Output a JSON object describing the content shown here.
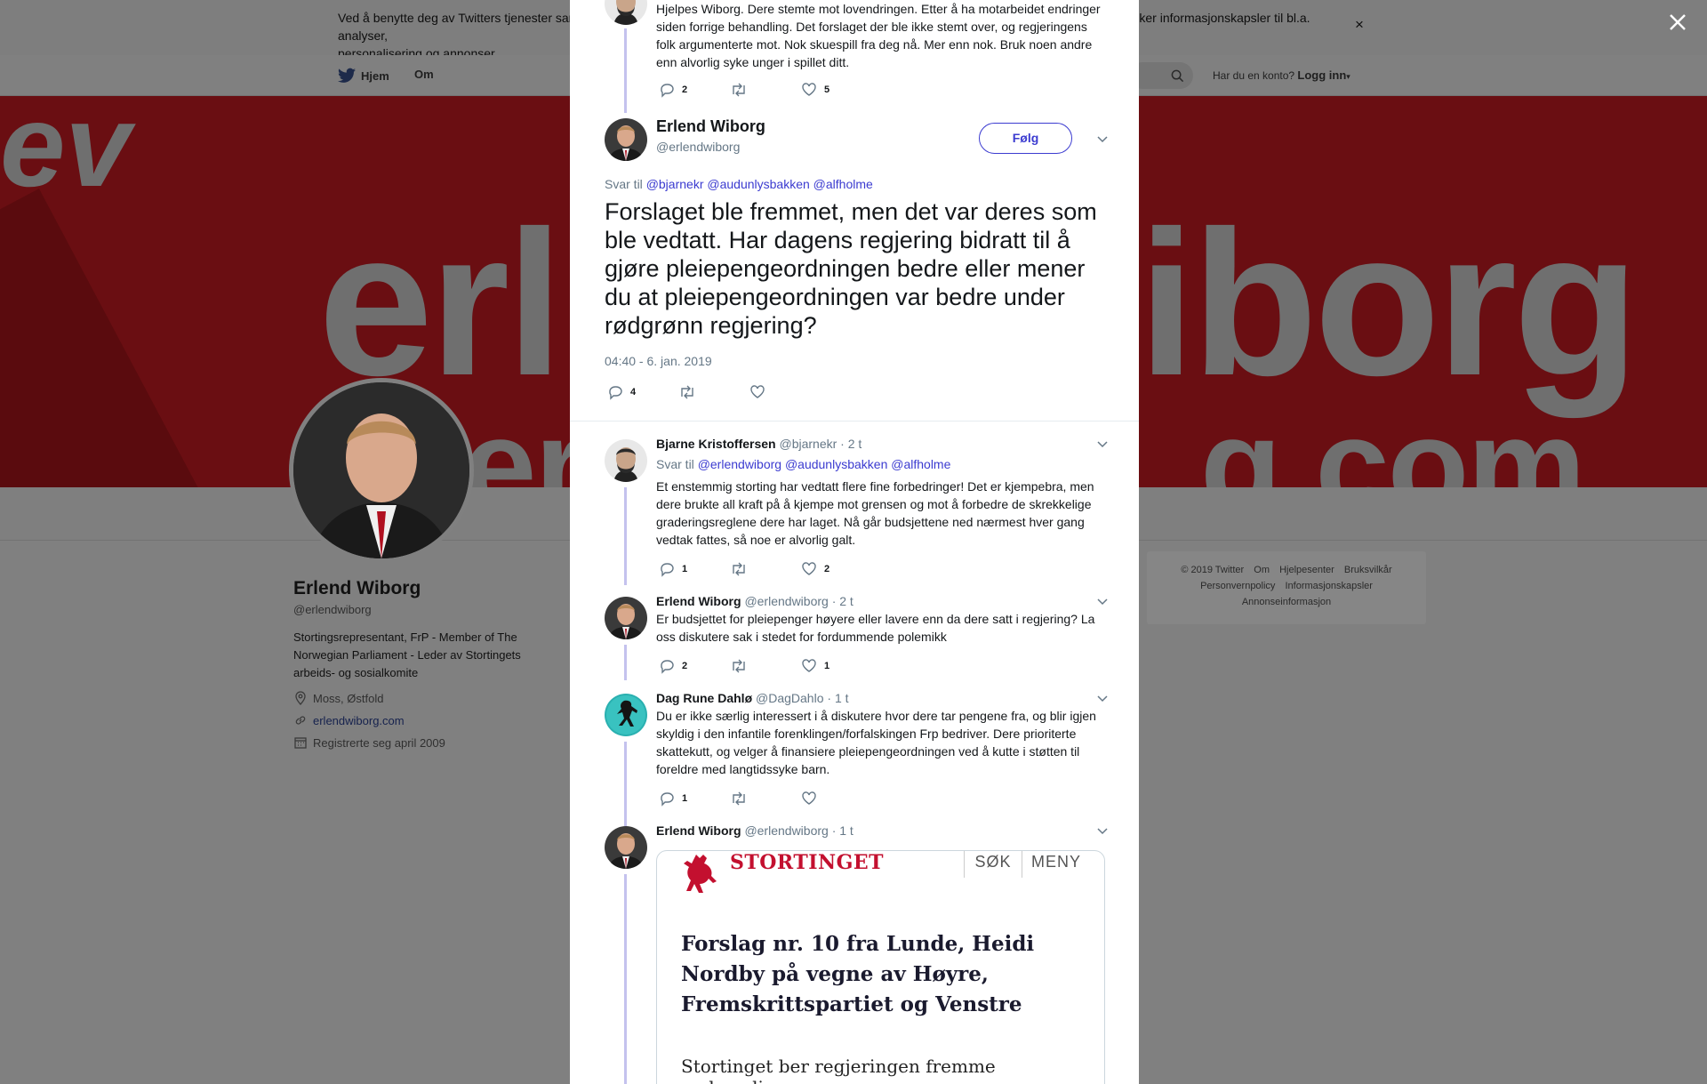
{
  "cookie_banner": {
    "text_line1": "Ved å benytte deg av Twitters tjenester samtykker du til vår bruk av informasjonskapsler og overføring av data utenfor EU. Vi og våre partnere bruker informasjonskapsler til bl.a. analyser,",
    "text_line2": "personalisering og annonser.",
    "close": "×"
  },
  "topnav": {
    "home": "Hjem",
    "about": "Om",
    "login_prompt": "Har du en konto?",
    "login": "Logg inn"
  },
  "profile": {
    "name": "Erlend Wiborg",
    "handle": "@erlendwiborg",
    "bio": "Stortingsrepresentant, FrP - Member of The Norwegian Parliament - Leder av Stortingets arbeids- og sosialkomite",
    "location": "Moss, Østfold",
    "website": "erlendwiborg.com",
    "joined": "Registrerte seg april 2009"
  },
  "footer": {
    "links": [
      "© 2019 Twitter",
      "Om",
      "Hjelpesenter",
      "Bruksvilkår",
      "Personvernpolicy",
      "Informasjonskapsler",
      "Annonseinformasjon"
    ]
  },
  "modal": {
    "prev_tweet": {
      "text": "Hjelpes Wiborg. Dere stemte mot lovendringen. Etter å ha motarbeidet endringer siden forrige behandling. Det forslaget der ble ikke stemt over, og regjeringens folk argumenterte mot. Nok skuespill fra deg nå. Mer enn nok. Bruk noen andre enn alvorlig syke unger i spillet ditt.",
      "replies": "2",
      "likes": "5"
    },
    "main_tweet": {
      "name": "Erlend Wiborg",
      "handle": "@erlendwiborg",
      "follow": "Følg",
      "reply_to_label": "Svar til",
      "reply_to": [
        "@bjarnekr",
        "@audunlysbakken",
        "@alfholme"
      ],
      "text": "Forslaget ble fremmet, men det var deres som ble vedtatt. Har dagens regjering bidratt til å gjøre pleiepengeordningen bedre eller mener du at pleiepengeordningen var bedre under rødgrønn regjering?",
      "time": "04:40 - 6. jan. 2019",
      "replies": "4"
    },
    "replies": [
      {
        "name": "Bjarne Kristoffersen",
        "handle": "@bjarnekr",
        "time": "· 2 t",
        "reply_to_label": "Svar til",
        "reply_to": [
          "@erlendwiborg",
          "@audunlysbakken",
          "@alfholme"
        ],
        "text": "Et enstemmig storting har vedtatt flere fine forbedringer! Det er kjempebra, men dere brukte all kraft på å kjempe mot grensen og mot å forbedre de skrekkelige graderingsreglene dere har laget. Nå går budsjettene ned nærmest hver gang vedtak fattes, så noe er alvorlig galt.",
        "replies": "1",
        "likes": "2"
      },
      {
        "name": "Erlend Wiborg",
        "handle": "@erlendwiborg",
        "time": "· 2 t",
        "text": "Er budsjettet for pleiepenger høyere eller lavere enn da dere satt i regjering? La oss diskutere sak i stedet for fordummende polemikk",
        "replies": "2",
        "likes": "1"
      },
      {
        "name": "Dag Rune Dahlø",
        "handle": "@DagDahlo",
        "time": "· 1 t",
        "text": "Du er ikke særlig interessert i å diskutere hvor dere tar pengene fra, og blir igjen skyldig i den infantile forenklingen/forfalskingen Frp bedriver. Dere prioriterte skattekutt, og velger å finansiere pleiepengeordningen ved å kutte i støtten til foreldre med langtidssyke barn.",
        "replies": "1",
        "likes": ""
      },
      {
        "name": "Erlend Wiborg",
        "handle": "@erlendwiborg",
        "time": "· 1 t"
      }
    ],
    "card": {
      "logo": "STORTINGET",
      "search": "SØK",
      "menu": "MENY",
      "headline": "Forslag nr. 10 fra Lunde, Heidi Nordby på vegne av Høyre, Fremskrittspartiet og Venstre",
      "lead": "Stortinget ber regjeringen fremme nødvendige"
    }
  },
  "colors": {
    "accent": "#3b3bd0",
    "thread_line": "#c4c2ee",
    "overlay": "#808080",
    "banner": "#6a0e12",
    "stortinget_red": "#c3102f"
  }
}
